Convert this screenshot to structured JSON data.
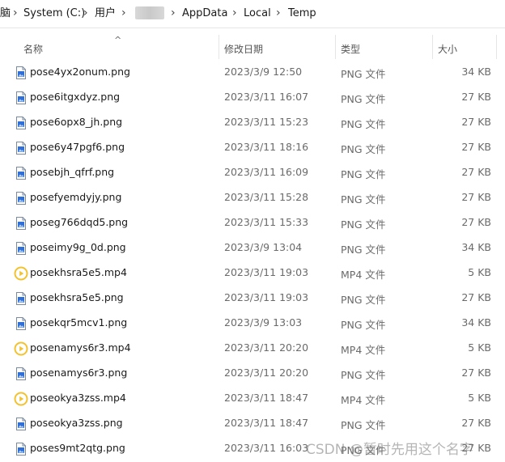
{
  "breadcrumb": {
    "partial": "脑",
    "drive": "System (C:)",
    "users": "用户",
    "appdata": "AppData",
    "local": "Local",
    "temp": "Temp"
  },
  "columns": {
    "name": "名称",
    "date": "修改日期",
    "type": "类型",
    "size": "大小"
  },
  "files": [
    {
      "name": "pose4yx2onum.png",
      "date": "2023/3/9 12:50",
      "type": "PNG 文件",
      "size": "34 KB",
      "icon": "png-file-icon"
    },
    {
      "name": "pose6itgxdyz.png",
      "date": "2023/3/11 16:07",
      "type": "PNG 文件",
      "size": "27 KB",
      "icon": "png-file-icon"
    },
    {
      "name": "pose6opx8_jh.png",
      "date": "2023/3/11 15:23",
      "type": "PNG 文件",
      "size": "27 KB",
      "icon": "png-file-icon"
    },
    {
      "name": "pose6y47pgf6.png",
      "date": "2023/3/11 18:16",
      "type": "PNG 文件",
      "size": "27 KB",
      "icon": "png-file-icon"
    },
    {
      "name": "posebjh_qfrf.png",
      "date": "2023/3/11 16:09",
      "type": "PNG 文件",
      "size": "27 KB",
      "icon": "png-file-icon"
    },
    {
      "name": "posefyemdyjy.png",
      "date": "2023/3/11 15:28",
      "type": "PNG 文件",
      "size": "27 KB",
      "icon": "png-file-icon"
    },
    {
      "name": "poseg766dqd5.png",
      "date": "2023/3/11 15:33",
      "type": "PNG 文件",
      "size": "27 KB",
      "icon": "png-file-icon"
    },
    {
      "name": "poseimy9g_0d.png",
      "date": "2023/3/9 13:04",
      "type": "PNG 文件",
      "size": "34 KB",
      "icon": "png-file-icon"
    },
    {
      "name": "posekhsra5e5.mp4",
      "date": "2023/3/11 19:03",
      "type": "MP4 文件",
      "size": "5 KB",
      "icon": "mp4-file-icon"
    },
    {
      "name": "posekhsra5e5.png",
      "date": "2023/3/11 19:03",
      "type": "PNG 文件",
      "size": "27 KB",
      "icon": "png-file-icon"
    },
    {
      "name": "posekqr5mcv1.png",
      "date": "2023/3/9 13:03",
      "type": "PNG 文件",
      "size": "34 KB",
      "icon": "png-file-icon"
    },
    {
      "name": "posenamys6r3.mp4",
      "date": "2023/3/11 20:20",
      "type": "MP4 文件",
      "size": "5 KB",
      "icon": "mp4-file-icon"
    },
    {
      "name": "posenamys6r3.png",
      "date": "2023/3/11 20:20",
      "type": "PNG 文件",
      "size": "27 KB",
      "icon": "png-file-icon"
    },
    {
      "name": "poseokya3zss.mp4",
      "date": "2023/3/11 18:47",
      "type": "MP4 文件",
      "size": "5 KB",
      "icon": "mp4-file-icon"
    },
    {
      "name": "poseokya3zss.png",
      "date": "2023/3/11 18:47",
      "type": "PNG 文件",
      "size": "27 KB",
      "icon": "png-file-icon"
    },
    {
      "name": "poses9mt2qtg.png",
      "date": "2023/3/11 16:03",
      "type": "PNG 文件",
      "size": "27 KB",
      "icon": "png-file-icon"
    }
  ],
  "watermark": "CSDN @暂时先用这个名字",
  "colors": {
    "png_icon_blue": "#2f6fd6",
    "mp4_icon_yellow": "#f2c230",
    "header_text": "#555555",
    "secondary_text": "#6a6a6a"
  }
}
